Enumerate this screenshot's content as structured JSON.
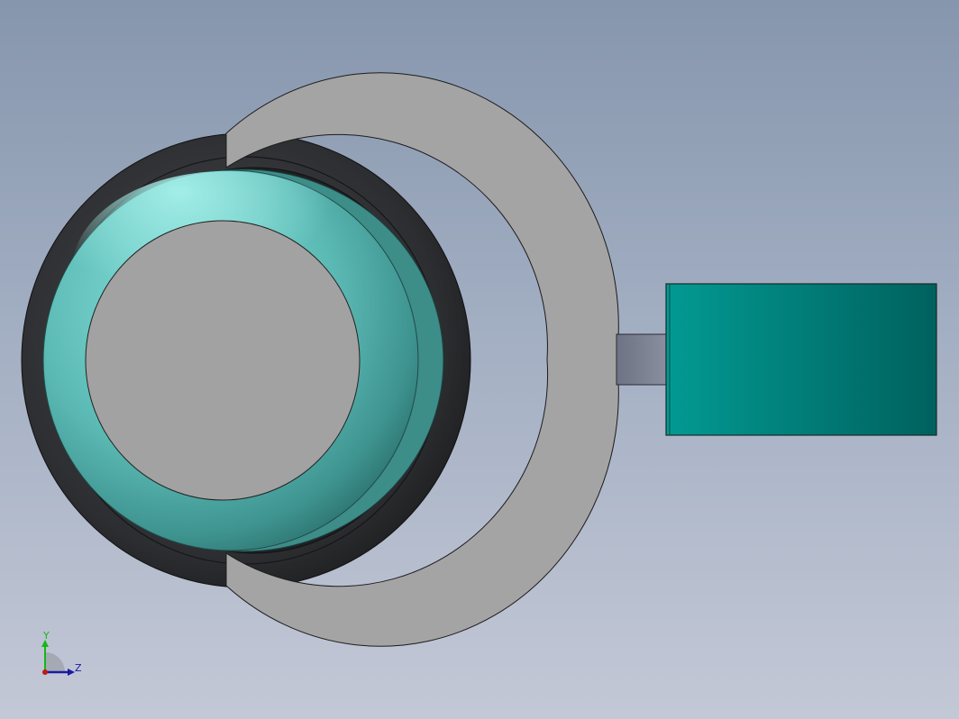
{
  "viewport": {
    "background_top": "#8696ad",
    "background_bottom": "#c3c8d6"
  },
  "model": {
    "parts": [
      {
        "name": "black-seal-ring",
        "color": "#2f3032"
      },
      {
        "name": "teal-torus-ring",
        "color": "#5fb8b4"
      },
      {
        "name": "gray-inner-disc",
        "color": "#a2a2a2"
      },
      {
        "name": "gray-crescent-clip",
        "color": "#a4a4a4"
      },
      {
        "name": "connector-stem",
        "color": "#7b8090"
      },
      {
        "name": "teal-block",
        "color": "#01807a"
      }
    ]
  },
  "triad": {
    "y_label": "Y",
    "z_label": "Z",
    "y_color": "#16b616",
    "z_color": "#1a1aa0",
    "origin_color": "#c01818"
  }
}
